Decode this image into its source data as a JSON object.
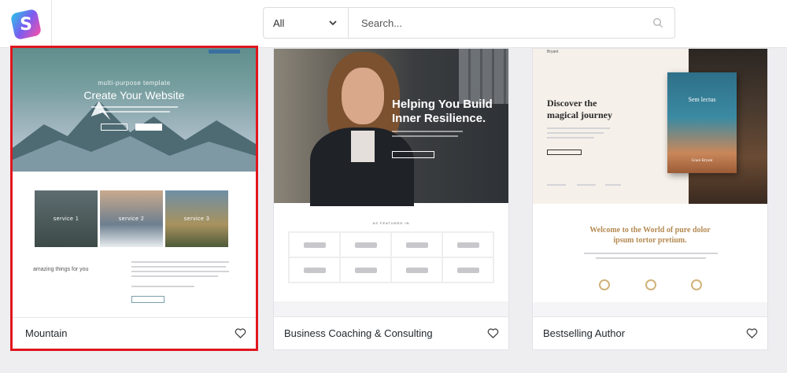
{
  "app": {
    "logo_letter": "S"
  },
  "search": {
    "filter_value": "All",
    "placeholder": "Search..."
  },
  "templates": [
    {
      "name": "Mountain",
      "selected": true,
      "preview": {
        "subtitle": "multi-purpose template",
        "title": "Create Your Website",
        "services": [
          "service 1",
          "service 2",
          "service 3"
        ],
        "section_heading": "amazing things for you"
      }
    },
    {
      "name": "Business Coaching & Consulting",
      "selected": false,
      "preview": {
        "title_line1": "Helping You Build",
        "title_line2": "Inner Resilience.",
        "featured_label": "AS FEATURED IN"
      }
    },
    {
      "name": "Bestselling Author",
      "selected": false,
      "preview": {
        "brand": "Bryant",
        "heading_line1": "Discover the",
        "heading_line2": "magical journey",
        "book_title": "Sem lectus",
        "book_author": "Grace Bryant",
        "welcome_line1": "Welcome to the World of pure dolor",
        "welcome_line2": "ipsum tortor pretium."
      }
    }
  ],
  "colors": {
    "selected_border": "#e0161e",
    "accent_gold": "#b48a52"
  },
  "icons": {
    "filter": "chevron-down-icon",
    "search": "search-icon",
    "favorite": "heart-icon"
  }
}
